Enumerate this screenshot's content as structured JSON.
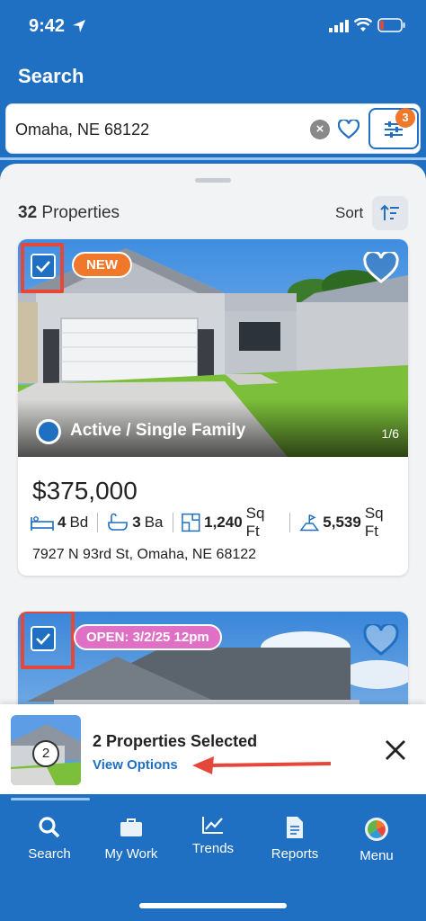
{
  "status_bar": {
    "time": "9:42"
  },
  "header": {
    "title": "Search"
  },
  "search": {
    "value": "Omaha, NE 68122",
    "filter_count": "3"
  },
  "results": {
    "count": "32",
    "count_label": "Properties",
    "sort_label": "Sort"
  },
  "listings": [
    {
      "badge": "NEW",
      "status": "Active / Single Family",
      "photo_index": "1/6",
      "price": "$375,000",
      "beds": "4",
      "beds_unit": "Bd",
      "baths": "3",
      "baths_unit": "Ba",
      "sqft": "1,240",
      "sqft_unit": "Sq Ft",
      "lot": "5,539",
      "lot_unit": "Sq Ft",
      "address": "7927 N 93rd St, Omaha, NE 68122",
      "house_number": "7927",
      "selected": true
    },
    {
      "badge": "OPEN: 3/2/25 12pm",
      "selected": true
    }
  ],
  "selection": {
    "count": "2",
    "title": "2 Properties Selected",
    "action": "View Options"
  },
  "tabs": [
    {
      "label": "Search",
      "icon": "search-icon"
    },
    {
      "label": "My Work",
      "icon": "briefcase-icon"
    },
    {
      "label": "Trends",
      "icon": "trends-icon"
    },
    {
      "label": "Reports",
      "icon": "reports-icon"
    },
    {
      "label": "Menu",
      "icon": "menu-logo-icon"
    }
  ],
  "colors": {
    "primary": "#1f6fc2",
    "new_badge": "#f0782b",
    "open_badge": "#e070c6",
    "highlight": "#e5483b"
  }
}
